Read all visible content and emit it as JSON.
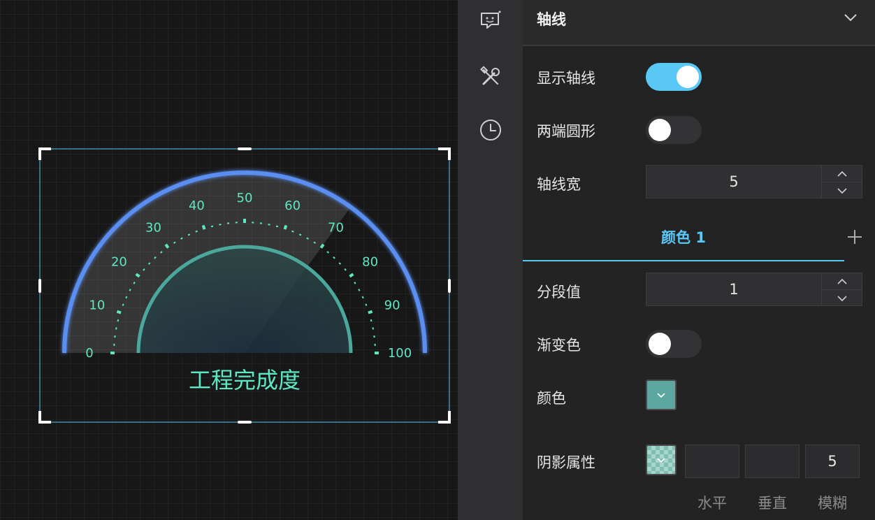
{
  "canvas": {
    "gauge": {
      "title": "工程完成度",
      "ticks": [
        "0",
        "10",
        "20",
        "30",
        "40",
        "50",
        "60",
        "70",
        "80",
        "90",
        "100"
      ],
      "value_percent": 70,
      "colors": {
        "arc": "#5a8ef0",
        "tick": "#5de8c3",
        "inner_arc": "#4aa89c"
      }
    }
  },
  "sidebar": {
    "icons": [
      "chat-icon",
      "tools-icon",
      "clock-icon"
    ]
  },
  "panel": {
    "section_title": "轴线",
    "show_axis": {
      "label": "显示轴线",
      "on": true
    },
    "round_ends": {
      "label": "两端圆形",
      "on": false
    },
    "axis_width": {
      "label": "轴线宽",
      "value": "5"
    },
    "color_tab": {
      "label": "颜色 1"
    },
    "segment": {
      "label": "分段值",
      "value": "1"
    },
    "gradient": {
      "label": "渐变色",
      "on": false
    },
    "color": {
      "label": "颜色",
      "value": "#5ca8a0"
    },
    "shadow": {
      "label": "阴影属性",
      "horizontal": {
        "label": "水平",
        "value": ""
      },
      "vertical": {
        "label": "垂直",
        "value": ""
      },
      "blur": {
        "label": "模糊",
        "value": "5"
      }
    },
    "accent": "#5ac8f5"
  }
}
